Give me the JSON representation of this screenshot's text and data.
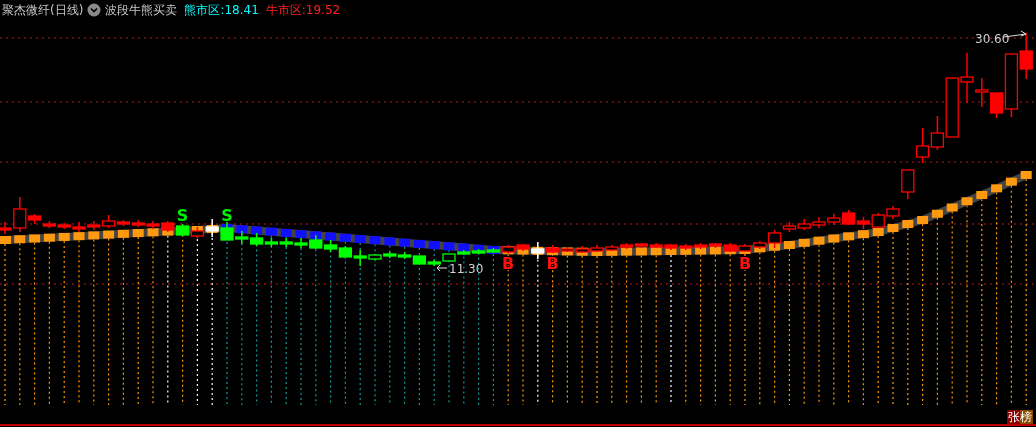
{
  "header": {
    "title": "聚杰微纤(日线)",
    "indicator": "波段牛熊买卖",
    "values": [
      {
        "label": "熊市区:",
        "value": "18.41",
        "color": "#00ffff"
      },
      {
        "label": "牛市区:",
        "value": "19.52",
        "color": "#ff2020"
      }
    ]
  },
  "chart": {
    "high_label": "30.60",
    "low_label": "11.30",
    "signals": [
      {
        "label": "S",
        "kind": "sell"
      },
      {
        "label": "S",
        "kind": "sell"
      },
      {
        "label": "B",
        "kind": "buy"
      },
      {
        "label": "B",
        "kind": "buy"
      },
      {
        "label": "B",
        "kind": "buy"
      }
    ]
  },
  "badge": {
    "text": "张榜"
  }
}
